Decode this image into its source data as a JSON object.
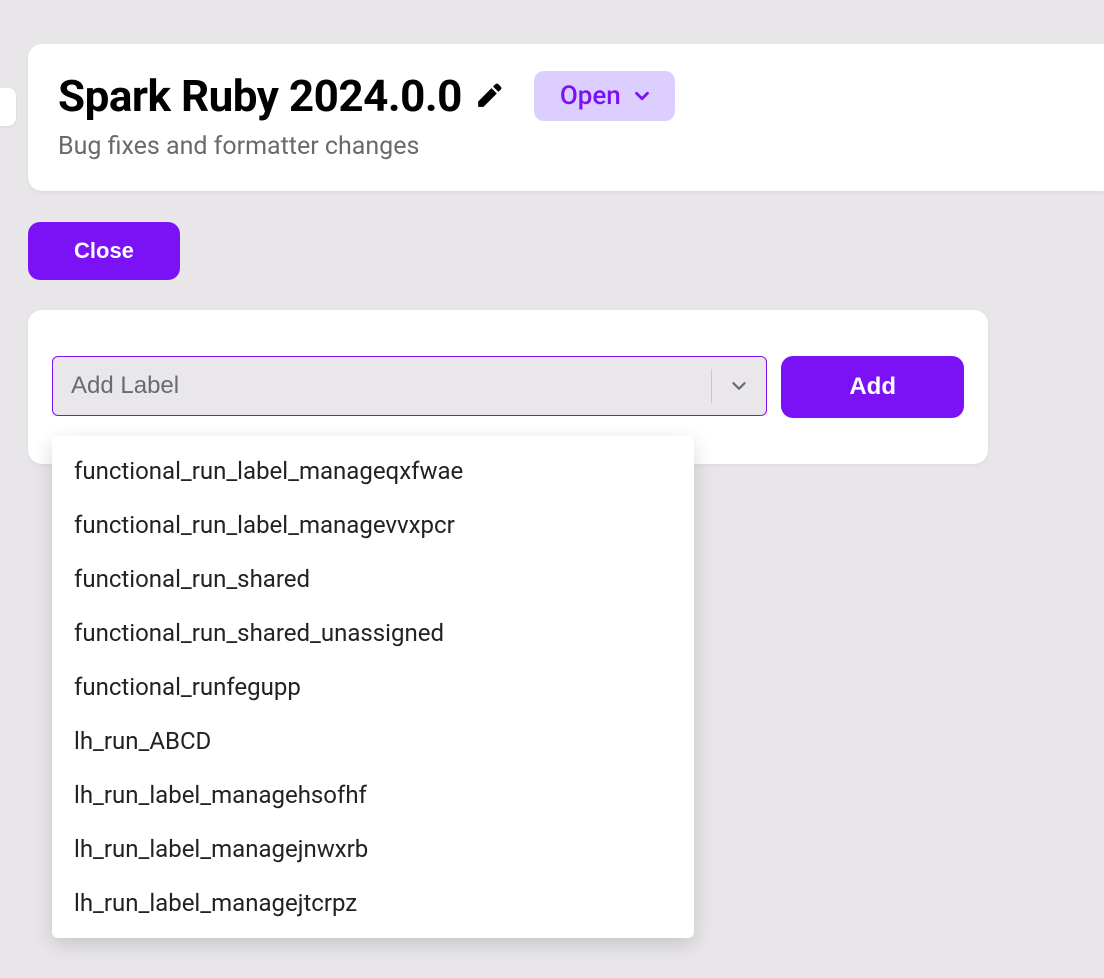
{
  "header": {
    "title": "Spark Ruby 2024.0.0",
    "subtitle": "Bug fixes and formatter changes",
    "status": "Open"
  },
  "actions": {
    "close_label": "Close",
    "add_label": "Add"
  },
  "label_input": {
    "placeholder": "Add Label"
  },
  "dropdown": {
    "options": [
      "functional_run_label_manageqxfwae",
      "functional_run_label_managevvxpcr",
      "functional_run_shared",
      "functional_run_shared_unassigned",
      "functional_runfegupp",
      "lh_run_ABCD",
      "lh_run_label_managehsofhf",
      "lh_run_label_managejnwxrb",
      "lh_run_label_managejtcrpz"
    ]
  }
}
